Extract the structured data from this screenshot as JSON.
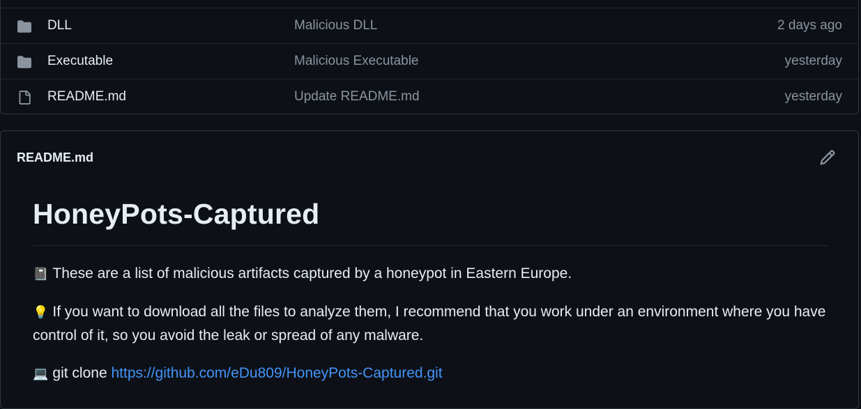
{
  "files": [
    {
      "type": "folder",
      "icon": "folder-icon",
      "name": "DLL",
      "message": "Malicious DLL",
      "time": "2 days ago"
    },
    {
      "type": "folder",
      "icon": "folder-icon",
      "name": "Executable",
      "message": "Malicious Executable",
      "time": "yesterday"
    },
    {
      "type": "file",
      "icon": "file-icon",
      "name": "README.md",
      "message": "Update README.md",
      "time": "yesterday"
    }
  ],
  "readme": {
    "filename": "README.md",
    "edit_icon": "pencil-icon",
    "title": "HoneyPots-Captured",
    "p1_emoji": "📓",
    "p1_text": "These are a list of malicious artifacts captured by a honeypot in Eastern Europe.",
    "p2_emoji": "💡",
    "p2_text": "If you want to download all the files to analyze them, I recommend that you work under an environment where you have control of it, so you avoid the leak or spread of any malware.",
    "p3_emoji": "💻",
    "p3_text": "git clone",
    "p3_link": "https://github.com/eDu809/HoneyPots-Captured.git"
  },
  "colors": {
    "background": "#0d1117",
    "border": "#30363d",
    "text": "#e6edf3",
    "muted": "#8b949e",
    "link": "#4493f8"
  }
}
